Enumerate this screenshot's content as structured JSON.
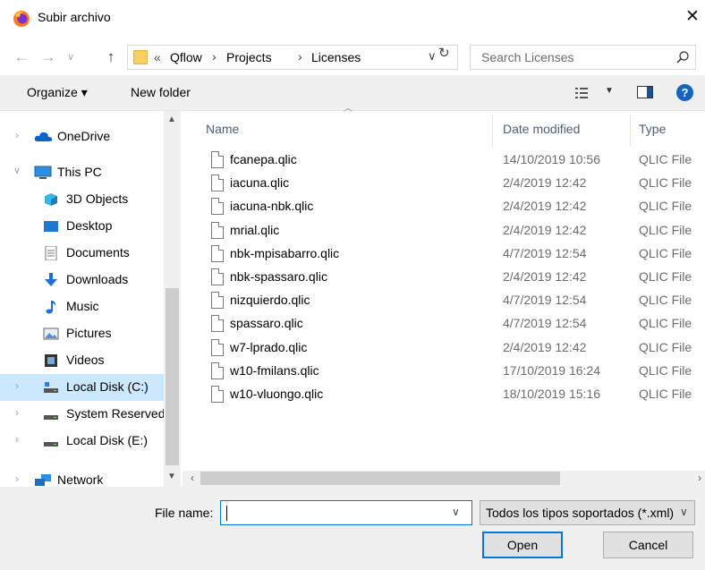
{
  "window": {
    "title": "Subir archivo"
  },
  "address": {
    "overflow": "«",
    "crumbs": [
      "Qflow",
      "Projects",
      "Licenses"
    ],
    "separator": "›"
  },
  "search": {
    "placeholder": "Search Licenses"
  },
  "toolbar": {
    "organize_label": "Organize ▾",
    "new_folder_label": "New folder",
    "help": "?"
  },
  "sidebar": {
    "items": [
      {
        "label": "OneDrive",
        "icon": "onedrive-icon",
        "expandable": true
      },
      {
        "label": "This PC",
        "icon": "computer-icon",
        "expanded": true
      },
      {
        "label": "3D Objects",
        "icon": "3d-objects-icon"
      },
      {
        "label": "Desktop",
        "icon": "desktop-icon"
      },
      {
        "label": "Documents",
        "icon": "documents-icon"
      },
      {
        "label": "Downloads",
        "icon": "downloads-icon"
      },
      {
        "label": "Music",
        "icon": "music-icon"
      },
      {
        "label": "Pictures",
        "icon": "pictures-icon"
      },
      {
        "label": "Videos",
        "icon": "videos-icon"
      },
      {
        "label": "Local Disk (C:)",
        "icon": "drive-icon",
        "selected": true
      },
      {
        "label": "System Reserved",
        "icon": "drive-icon"
      },
      {
        "label": "Local Disk (E:)",
        "icon": "drive-icon"
      },
      {
        "label": "Network",
        "icon": "network-icon"
      }
    ]
  },
  "columns": {
    "name": "Name",
    "date": "Date modified",
    "type": "Type"
  },
  "files": [
    {
      "name": "fcanepa.qlic",
      "date": "14/10/2019 10:56",
      "type": "QLIC File"
    },
    {
      "name": "iacuna.qlic",
      "date": "2/4/2019 12:42",
      "type": "QLIC File"
    },
    {
      "name": "iacuna-nbk.qlic",
      "date": "2/4/2019 12:42",
      "type": "QLIC File"
    },
    {
      "name": "mrial.qlic",
      "date": "2/4/2019 12:42",
      "type": "QLIC File"
    },
    {
      "name": "nbk-mpisabarro.qlic",
      "date": "4/7/2019 12:54",
      "type": "QLIC File"
    },
    {
      "name": "nbk-spassaro.qlic",
      "date": "2/4/2019 12:42",
      "type": "QLIC File"
    },
    {
      "name": "nizquierdo.qlic",
      "date": "4/7/2019 12:54",
      "type": "QLIC File"
    },
    {
      "name": "spassaro.qlic",
      "date": "4/7/2019 12:54",
      "type": "QLIC File"
    },
    {
      "name": "w7-lprado.qlic",
      "date": "2/4/2019 12:42",
      "type": "QLIC File"
    },
    {
      "name": "w10-fmilans.qlic",
      "date": "17/10/2019 16:24",
      "type": "QLIC File"
    },
    {
      "name": "w10-vluongo.qlic",
      "date": "18/10/2019 15:16",
      "type": "QLIC File"
    }
  ],
  "bottom": {
    "file_name_label": "File name:",
    "file_name_value": "",
    "file_type": "Todos los tipos soportados (*.xml)",
    "open_label": "Open",
    "cancel_label": "Cancel"
  },
  "colors": {
    "accent": "#0078d7",
    "selection": "#cce8ff",
    "header_text": "#4c607a"
  }
}
